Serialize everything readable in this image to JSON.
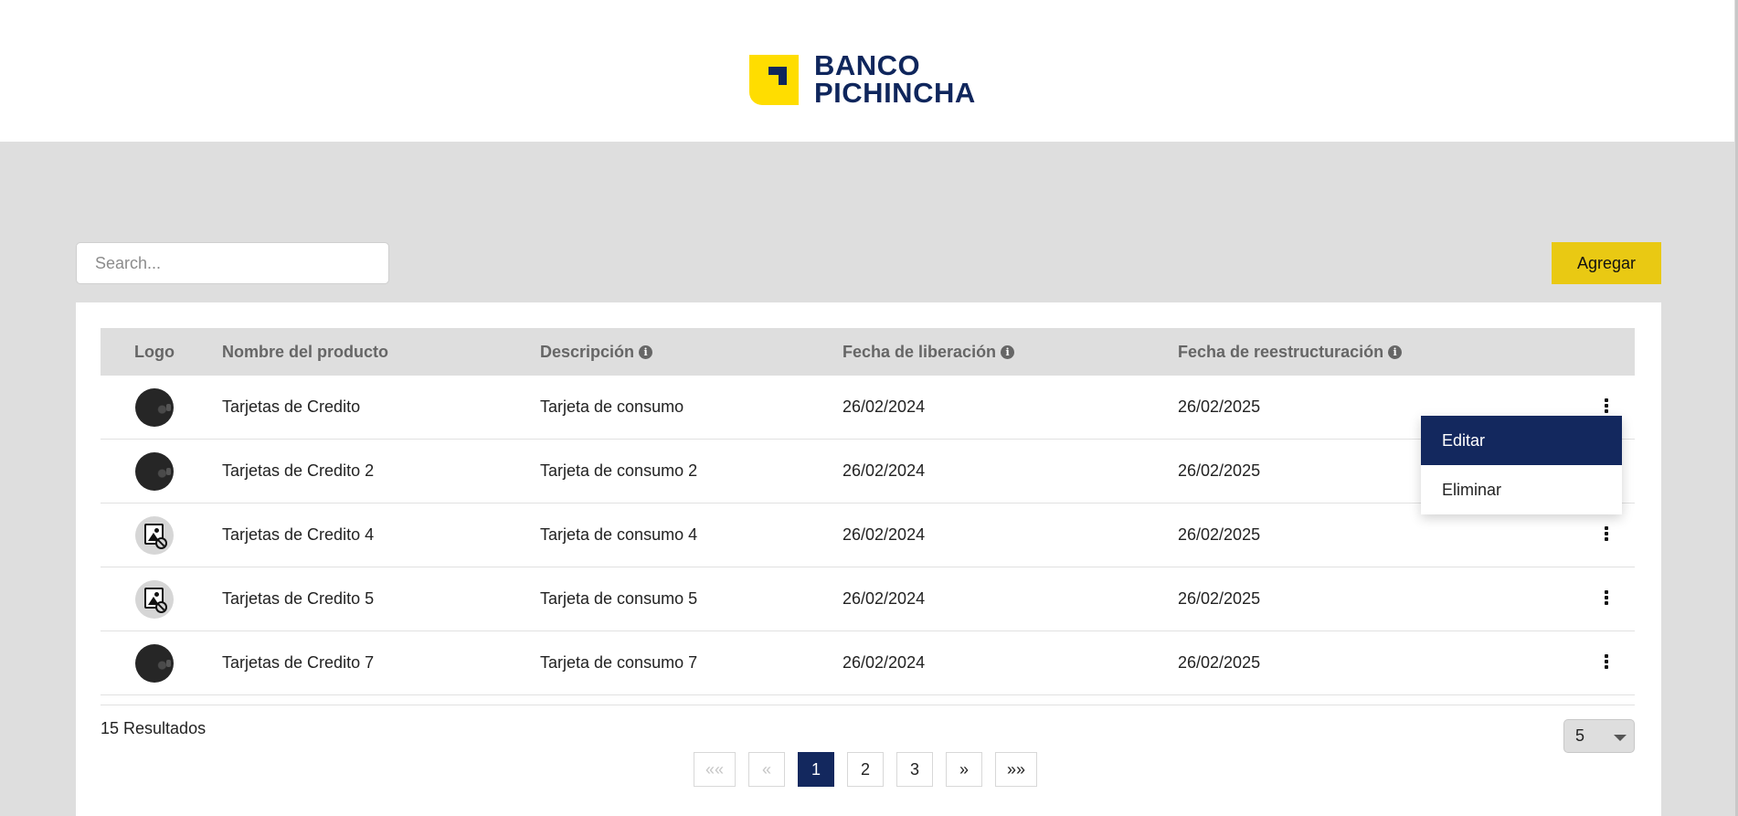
{
  "brand": {
    "line1": "BANCO",
    "line2": "PICHINCHA"
  },
  "search": {
    "placeholder": "Search...",
    "value": ""
  },
  "toolbar": {
    "add_label": "Agregar"
  },
  "table": {
    "headers": {
      "logo": "Logo",
      "name": "Nombre del producto",
      "description": "Descripción",
      "release_date": "Fecha de liberación",
      "restructure_date": "Fecha de reestructuración"
    },
    "rows": [
      {
        "logo": "dark-card-image",
        "name": "Tarjetas de Credito",
        "description": "Tarjeta de consumo",
        "release_date": "26/02/2024",
        "restructure_date": "26/02/2025"
      },
      {
        "logo": "dark-card-image",
        "name": "Tarjetas de Credito 2",
        "description": "Tarjeta de consumo 2",
        "release_date": "26/02/2024",
        "restructure_date": "26/02/2025"
      },
      {
        "logo": "broken-image-icon",
        "name": "Tarjetas de Credito 4",
        "description": "Tarjeta de consumo 4",
        "release_date": "26/02/2024",
        "restructure_date": "26/02/2025"
      },
      {
        "logo": "broken-image-icon",
        "name": "Tarjetas de Credito 5",
        "description": "Tarjeta de consumo 5",
        "release_date": "26/02/2024",
        "restructure_date": "26/02/2025"
      },
      {
        "logo": "dark-card-image",
        "name": "Tarjetas de Credito 7",
        "description": "Tarjeta de consumo 7",
        "release_date": "26/02/2024",
        "restructure_date": "26/02/2025"
      }
    ]
  },
  "footer": {
    "results": "15 Resultados",
    "page_size": "5"
  },
  "pagination": {
    "first": "««",
    "prev": "«",
    "pages": [
      "1",
      "2",
      "3"
    ],
    "current": "1",
    "next": "»",
    "last": "»»"
  },
  "context_menu": {
    "items": [
      "Editar",
      "Eliminar"
    ],
    "highlighted": "Editar"
  },
  "colors": {
    "brand_yellow": "#ffdd00",
    "brand_navy": "#0f265c",
    "add_button": "#e9c913",
    "active_page": "#13285e",
    "background": "#dedede"
  }
}
